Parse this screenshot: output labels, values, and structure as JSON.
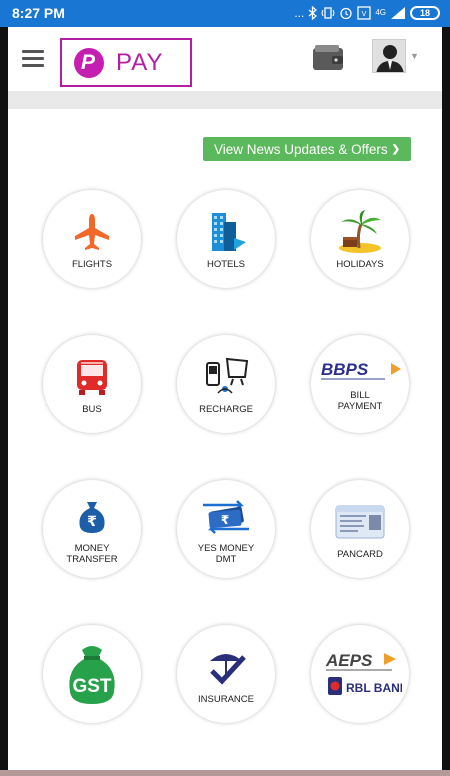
{
  "status_bar": {
    "time": "8:27 PM",
    "dots": "...",
    "network": "4G",
    "battery": "18"
  },
  "header": {
    "logo_letter": "P",
    "logo_text": "PAY"
  },
  "news_button": {
    "label": "View News Updates & Offers"
  },
  "services": [
    {
      "label": "FLIGHTS",
      "icon": "airplane-icon"
    },
    {
      "label": "HOTELS",
      "icon": "building-icon"
    },
    {
      "label": "HOLIDAYS",
      "icon": "palm-tree-icon"
    },
    {
      "label": "BUS",
      "icon": "bus-icon"
    },
    {
      "label": "RECHARGE",
      "icon": "mobile-tv-icon"
    },
    {
      "label": "BILL\nPAYMENT",
      "icon": "bbps-icon",
      "logo_text": "BBPS"
    },
    {
      "label": "MONEY\nTRANSFER",
      "icon": "money-bag-icon"
    },
    {
      "label": "YES MONEY\nDMT",
      "icon": "currency-transfer-icon"
    },
    {
      "label": "PANCARD",
      "icon": "pancard-icon"
    },
    {
      "label": "",
      "icon": "gst-bag-icon",
      "logo_text": "GST"
    },
    {
      "label": "INSURANCE",
      "icon": "umbrella-check-icon"
    },
    {
      "label": "",
      "icon": "aeps-rbl-icon",
      "logo_text": "AEPS",
      "bank_text": "RBL BANK"
    }
  ],
  "colors": {
    "status_bar": "#1976d2",
    "brand": "#b21fa3",
    "news_button": "#5cb85c"
  }
}
